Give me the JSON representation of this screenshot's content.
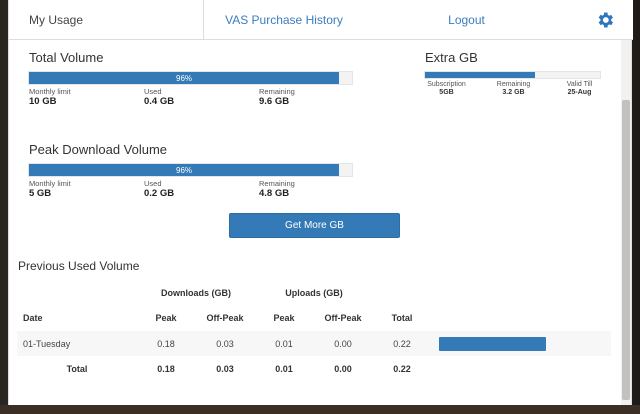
{
  "nav": {
    "my_usage": "My Usage",
    "vas_history": "VAS Purchase History",
    "logout": "Logout",
    "settings_icon": "gear-icon"
  },
  "total_volume": {
    "title": "Total Volume",
    "percent_label": "96%",
    "percent": 96,
    "monthly_limit_label": "Monthly limit",
    "monthly_limit": "10 GB",
    "used_label": "Used",
    "used": "0.4 GB",
    "remaining_label": "Remaining",
    "remaining": "9.6 GB"
  },
  "peak_volume": {
    "title": "Peak Download Volume",
    "percent_label": "96%",
    "percent": 96,
    "monthly_limit_label": "Monthly limit",
    "monthly_limit": "5 GB",
    "used_label": "Used",
    "used": "0.2 GB",
    "remaining_label": "Remaining",
    "remaining": "4.8 GB"
  },
  "extra_gb": {
    "title": "Extra GB",
    "fill_percent": 63,
    "subscription_label": "Subscription",
    "subscription": "5GB",
    "remaining_label": "Remaining",
    "remaining": "3.2 GB",
    "valid_label": "Valid Till",
    "valid": "25-Aug"
  },
  "get_more_button": "Get More GB",
  "previous": {
    "title": "Previous Used Volume",
    "group_downloads": "Downloads (GB)",
    "group_uploads": "Uploads (GB)",
    "headers": {
      "date": "Date",
      "dl_peak": "Peak",
      "dl_offpeak": "Off-Peak",
      "ul_peak": "Peak",
      "ul_offpeak": "Off-Peak",
      "total": "Total"
    },
    "rows": [
      {
        "date": "01-Tuesday",
        "dl_peak": "0.18",
        "dl_offpeak": "0.03",
        "ul_peak": "0.01",
        "ul_offpeak": "0.00",
        "total": "0.22"
      }
    ],
    "footer": {
      "label": "Total",
      "dl_peak": "0.18",
      "dl_offpeak": "0.03",
      "ul_peak": "0.01",
      "ul_offpeak": "0.00",
      "total": "0.22"
    }
  },
  "colors": {
    "accent": "#337ab7",
    "link": "#3a7dc0"
  }
}
